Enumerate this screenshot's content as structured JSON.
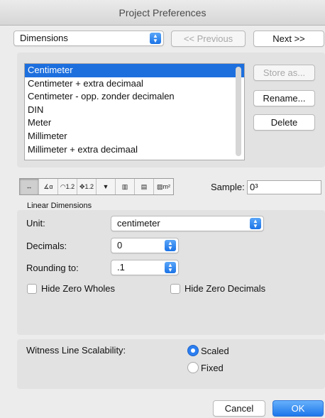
{
  "window": {
    "title": "Project Preferences"
  },
  "nav": {
    "category": "Dimensions",
    "previous_label": "<< Previous",
    "next_label": "Next >>"
  },
  "standards": {
    "items": [
      "Centimeter",
      "Centimeter + extra decimaal",
      "Centimeter - opp. zonder decimalen",
      "DIN",
      "Meter",
      "Millimeter",
      "Millimeter + extra decimaal"
    ],
    "selected_index": 0,
    "store_as_label": "Store as...",
    "rename_label": "Rename...",
    "delete_label": "Delete"
  },
  "toolbar": {
    "icons": [
      {
        "name": "linear-dimension-icon",
        "glyph": "↔"
      },
      {
        "name": "angular-dimension-icon",
        "glyph": "∡α"
      },
      {
        "name": "radial-dimension-icon",
        "glyph": "◠1.2"
      },
      {
        "name": "point-dimension-icon",
        "glyph": "✥1.2"
      },
      {
        "name": "level-dimension-icon",
        "glyph": "▼"
      },
      {
        "name": "elevation-dimension-icon",
        "glyph": "▥"
      },
      {
        "name": "wall-dimension-icon",
        "glyph": "▤"
      },
      {
        "name": "area-dimension-icon",
        "glyph": "▨m²"
      }
    ],
    "sample_label": "Sample:",
    "sample_value": "0³"
  },
  "linear": {
    "section_title": "Linear Dimensions",
    "unit_label": "Unit:",
    "unit_value": "centimeter",
    "decimals_label": "Decimals:",
    "decimals_value": "0",
    "rounding_label": "Rounding to:",
    "rounding_value": ".1",
    "hide_zero_wholes_label": "Hide Zero Wholes",
    "hide_zero_decimals_label": "Hide Zero Decimals"
  },
  "witness": {
    "label": "Witness Line Scalability:",
    "scaled_label": "Scaled",
    "fixed_label": "Fixed",
    "selected": "Scaled"
  },
  "footer": {
    "cancel_label": "Cancel",
    "ok_label": "OK"
  },
  "colors": {
    "accent": "#1d6fde",
    "selection": "#1d6fde"
  }
}
